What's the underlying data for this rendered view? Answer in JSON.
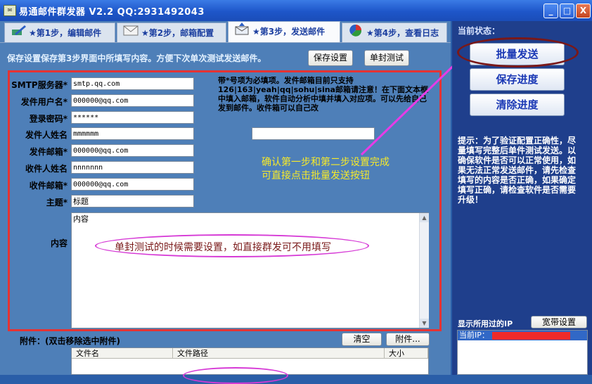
{
  "window": {
    "app_icon": "mail-icon",
    "title": "易通邮件群发器 V2.2   QQ:2931492043",
    "minimize": "_",
    "maximize": "□",
    "close": "X"
  },
  "tabs": [
    {
      "label": "★第1步，编辑邮件",
      "icon": "pen-icon"
    },
    {
      "label": "★第2步，邮箱配置",
      "icon": "envelope-icon"
    },
    {
      "label": "★第3步，发送邮件",
      "icon": "send-mail-icon",
      "active": true
    },
    {
      "label": "★第4步，查看日志",
      "icon": "chart-icon"
    }
  ],
  "tip": "保存设置保存第3步界面中所填写内容。方便下次单次测试发送邮件。",
  "buttons": {
    "save_settings": "保存设置",
    "single_test": "单封测试"
  },
  "form": {
    "smtp_label": "SMTP服务器*",
    "smtp_value": "smtp.qq.com",
    "user_label": "发件用户名*",
    "user_value": "000000@qq.com",
    "pass_label": "登录密码*",
    "pass_value": "******",
    "sender_name_label": "发件人姓名",
    "sender_name_value": "mmmmmm",
    "sender_email_label": "发件邮箱*",
    "sender_email_value": "000000@qq.com",
    "recv_name_label": "收件人姓名",
    "recv_name_value": "nnnnnnn",
    "recv_email_label": "收件邮箱*",
    "recv_email_value": "000000@qq.com",
    "subject_label": "主题*",
    "subject_value": "标题",
    "content_label": "内容",
    "content_value": "内容"
  },
  "note": "带*号项为必填项。发件邮箱目前只支持126|163|yeah|qq|sohu|sina邮箱请注意！在下面文本框中填入邮箱，软件自动分析中填并填入对应项。可以先给自己发到邮件。收件箱可以自己改",
  "annotations": {
    "steps_line1": "确认第一步和第二步设置完成",
    "steps_line2": "可直接点击批量发送按钮",
    "test_note": "单封测试的时候需要设置，如直接群发可不用填写"
  },
  "attachments": {
    "label": "附件：(双击移除选中附件)",
    "clear": "清空",
    "add": "附件...",
    "columns": [
      "文件名",
      "文件路径",
      "大小"
    ]
  },
  "right": {
    "status_label": "当前状态：",
    "batch_send": "批量发送",
    "save_progress": "保存进度",
    "clear_progress": "清除进度",
    "hint": "提示：为了验证配置正确性，尽量填写完整后单件测试发送。以确保软件是否可以正常使用，如果无法正常发送邮件，请先检查填写的内容是否正确，如果确定填写正确，请检查软件是否需要升级！",
    "ip_label": "显示所用过的IP",
    "broadband_settings": "宽带设置",
    "current_ip": "当前IP："
  },
  "colors": {
    "accent_red": "#e53333",
    "annotation_magenta": "#d63ad6",
    "annotation_yellow": "#f7ea2a"
  }
}
